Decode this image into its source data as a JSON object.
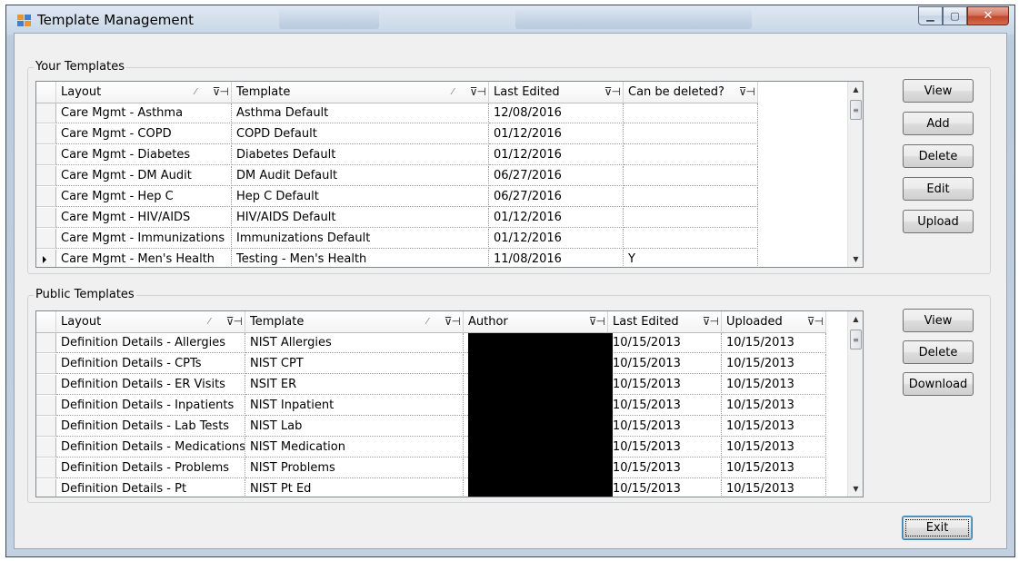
{
  "window": {
    "title": "Template Management"
  },
  "your_templates": {
    "group_label": "Your Templates",
    "columns": [
      "Layout",
      "Template",
      "Last Edited",
      "Can be deleted?"
    ],
    "rows": [
      {
        "layout": "Care Mgmt - Asthma",
        "template": "Asthma Default",
        "last_edited": "12/08/2016",
        "can_delete": ""
      },
      {
        "layout": "Care Mgmt - COPD",
        "template": "COPD Default",
        "last_edited": "01/12/2016",
        "can_delete": ""
      },
      {
        "layout": "Care Mgmt - Diabetes",
        "template": "Diabetes Default",
        "last_edited": "01/12/2016",
        "can_delete": ""
      },
      {
        "layout": "Care Mgmt - DM Audit",
        "template": "DM Audit Default",
        "last_edited": "06/27/2016",
        "can_delete": ""
      },
      {
        "layout": "Care Mgmt - Hep C",
        "template": "Hep C Default",
        "last_edited": "06/27/2016",
        "can_delete": ""
      },
      {
        "layout": "Care Mgmt - HIV/AIDS",
        "template": "HIV/AIDS Default",
        "last_edited": "01/12/2016",
        "can_delete": ""
      },
      {
        "layout": "Care Mgmt - Immunizations",
        "template": "Immunizations Default",
        "last_edited": "01/12/2016",
        "can_delete": ""
      },
      {
        "layout": "Care Mgmt - Men's Health",
        "template": "Testing - Men's Health",
        "last_edited": "11/08/2016",
        "can_delete": "Y"
      }
    ],
    "buttons": {
      "view": "View",
      "add": "Add",
      "delete": "Delete",
      "edit": "Edit",
      "upload": "Upload"
    }
  },
  "public_templates": {
    "group_label": "Public Templates",
    "columns": [
      "Layout",
      "Template",
      "Author",
      "Last Edited",
      "Uploaded"
    ],
    "rows": [
      {
        "layout": "Definition Details - Allergies",
        "template": "NIST Allergies",
        "last_edited": "10/15/2013",
        "uploaded": "10/15/2013"
      },
      {
        "layout": "Definition Details - CPTs",
        "template": "NIST CPT",
        "last_edited": "10/15/2013",
        "uploaded": "10/15/2013"
      },
      {
        "layout": "Definition Details - ER Visits",
        "template": "NSIT ER",
        "last_edited": "10/15/2013",
        "uploaded": "10/15/2013"
      },
      {
        "layout": "Definition Details - Inpatients",
        "template": "NIST Inpatient",
        "last_edited": "10/15/2013",
        "uploaded": "10/15/2013"
      },
      {
        "layout": "Definition Details - Lab Tests",
        "template": "NIST Lab",
        "last_edited": "10/15/2013",
        "uploaded": "10/15/2013"
      },
      {
        "layout": "Definition Details - Medications",
        "template": "NIST Medication",
        "last_edited": "10/15/2013",
        "uploaded": "10/15/2013"
      },
      {
        "layout": "Definition Details - Problems",
        "template": "NIST Problems",
        "last_edited": "10/15/2013",
        "uploaded": "10/15/2013"
      },
      {
        "layout": "Definition Details - Pt",
        "template": "NIST Pt Ed",
        "last_edited": "10/15/2013",
        "uploaded": "10/15/2013"
      }
    ],
    "buttons": {
      "view": "View",
      "delete": "Delete",
      "download": "Download"
    }
  },
  "footer": {
    "exit": "Exit"
  },
  "icons": {
    "column_header": [
      "filter-icon",
      "pin-icon",
      "sort-indicator-icon"
    ],
    "scrollbar": [
      "scroll-up-icon",
      "scroll-down-icon"
    ],
    "window": [
      "app-icon",
      "minimize-icon",
      "maximize-icon",
      "close-icon"
    ],
    "row_indicator": "current-row-arrow-icon"
  },
  "colors": {
    "title_bar": "#c7d6e6",
    "close_button": "#c2462c",
    "form_background": "#f0f0f0",
    "grid_background": "#ffffff",
    "redaction": "#000000"
  }
}
